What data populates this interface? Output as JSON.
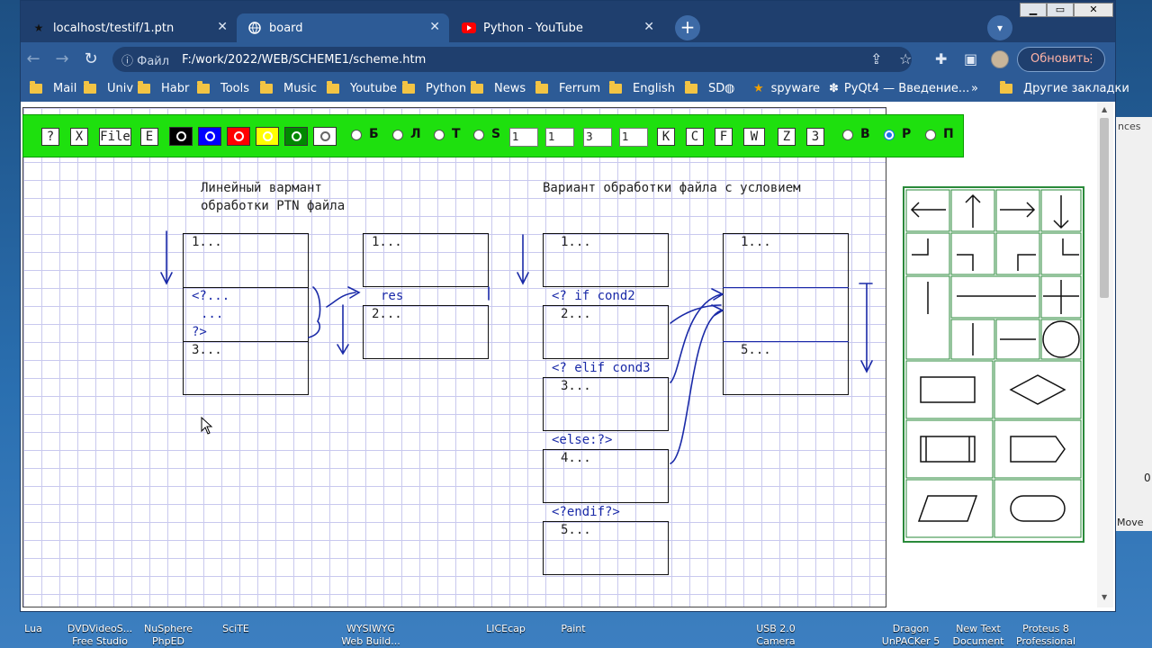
{
  "window": {
    "tabs": [
      {
        "title": "localhost/testif/1.ptn",
        "icon": "star-icon",
        "active": false
      },
      {
        "title": "board",
        "icon": "globe-icon",
        "active": true
      },
      {
        "title": "Python - YouTube",
        "icon": "youtube-icon",
        "active": false
      }
    ],
    "new_tab": "+",
    "tab_dropdown": "⌄"
  },
  "address_bar": {
    "info_label": "Файл",
    "url": "F:/work/2022/WEB/SCHEME1/scheme.htm",
    "update_label": "Обновить"
  },
  "bookmarks": {
    "items": [
      "Mail",
      "Univ",
      "Habr",
      "Tools",
      "Music",
      "Youtube",
      "Python",
      "News",
      "Ferrum",
      "English",
      "SD"
    ],
    "spyware": "spyware",
    "pyqt": "PyQt4 — Введение...",
    "more": "»",
    "other": "Другие закладки"
  },
  "toolbar": {
    "btn_help": "?",
    "btn_x": "X",
    "btn_file": "File",
    "btn_e": "E",
    "colors": [
      "#000000",
      "#0000ff",
      "#ff0000",
      "#ffff00",
      "#008000",
      "#ffffff"
    ],
    "radio_labels": [
      "Б",
      "Л",
      "Т",
      "S"
    ],
    "inputs": [
      "1",
      "1",
      "3",
      "1"
    ],
    "btn_k": "K",
    "btn_c": "C",
    "btn_f": "F",
    "btn_w": "W",
    "btn_z": "Z",
    "btn_3": "З",
    "mode_labels": [
      "В",
      "Р",
      "П"
    ],
    "mode_selected": "Р"
  },
  "canvas": {
    "title_left_1": "Линейный вармант",
    "title_left_2": "обработки PTN файла",
    "title_right": "Вариант обработки файла с условием",
    "left_box_1": "1...",
    "left_box_2a": "<?...",
    "left_box_2b": "...",
    "left_box_2c": "?>",
    "left_box_3": "3...",
    "mid_box_1": "1...",
    "mid_res": "res",
    "mid_box_2": "2...",
    "r_box_1": "1...",
    "r_if": "<? if cond2",
    "r_box_2": "2...",
    "r_elif": "<? elif cond3",
    "r_box_3": "3...",
    "r_else": "<else:?>",
    "r_box_4": "4...",
    "r_endif": "<?endif?>",
    "r_box_5": "5...",
    "rr_box_1": "1...",
    "rr_box_5": "5..."
  },
  "desktop": {
    "right_label": "nces",
    "right_zero": "0",
    "right_move": "Move",
    "icons": [
      {
        "line1": "Lua",
        "line2": ""
      },
      {
        "line1": "DVDVideoS...",
        "line2": "Free Studio"
      },
      {
        "line1": "NuSphere",
        "line2": "PhpED"
      },
      {
        "line1": "SciTE",
        "line2": ""
      },
      {
        "line1": "WYSIWYG",
        "line2": "Web Build..."
      },
      {
        "line1": "LICEcap",
        "line2": ""
      },
      {
        "line1": "Paint",
        "line2": ""
      },
      {
        "line1": "USB 2.0",
        "line2": "Camera"
      },
      {
        "line1": "Dragon",
        "line2": "UnPACKer 5"
      },
      {
        "line1": "New Text",
        "line2": "Document"
      },
      {
        "line1": "Proteus 8",
        "line2": "Professional"
      }
    ]
  }
}
